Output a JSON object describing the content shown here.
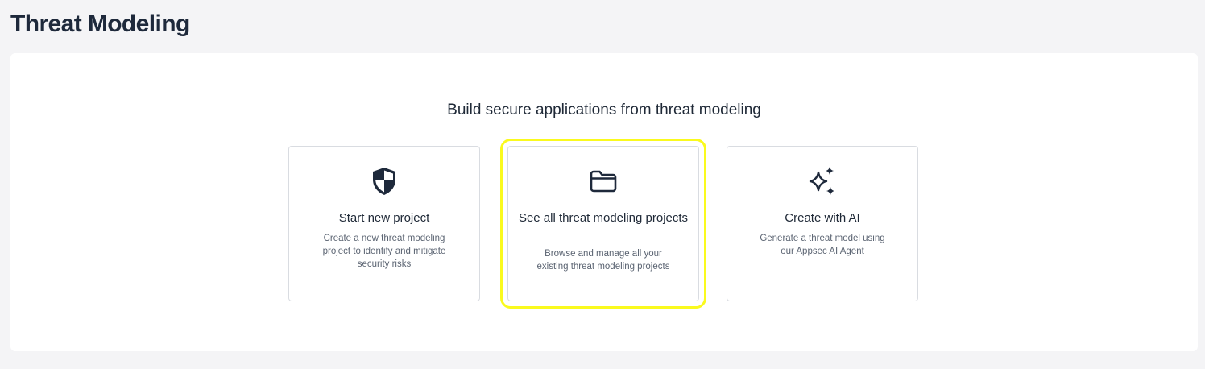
{
  "page": {
    "title": "Threat Modeling"
  },
  "main": {
    "headline": "Build secure applications from threat modeling",
    "cards": [
      {
        "title": "Start new project",
        "description": "Create a new threat modeling project to identify and mitigate security risks",
        "icon": "shield-icon"
      },
      {
        "title": "See all threat modeling projects",
        "description": "Browse and manage all your existing threat modeling projects",
        "icon": "folder-icon",
        "highlighted": true
      },
      {
        "title": "Create with AI",
        "description": "Generate a threat model using our Appsec AI Agent",
        "icon": "sparkles-icon"
      }
    ]
  },
  "colors": {
    "background": "#f4f4f6",
    "panel": "#ffffff",
    "heading": "#1e293b",
    "icon": "#1e293b",
    "highlight": "#fafa1e"
  }
}
